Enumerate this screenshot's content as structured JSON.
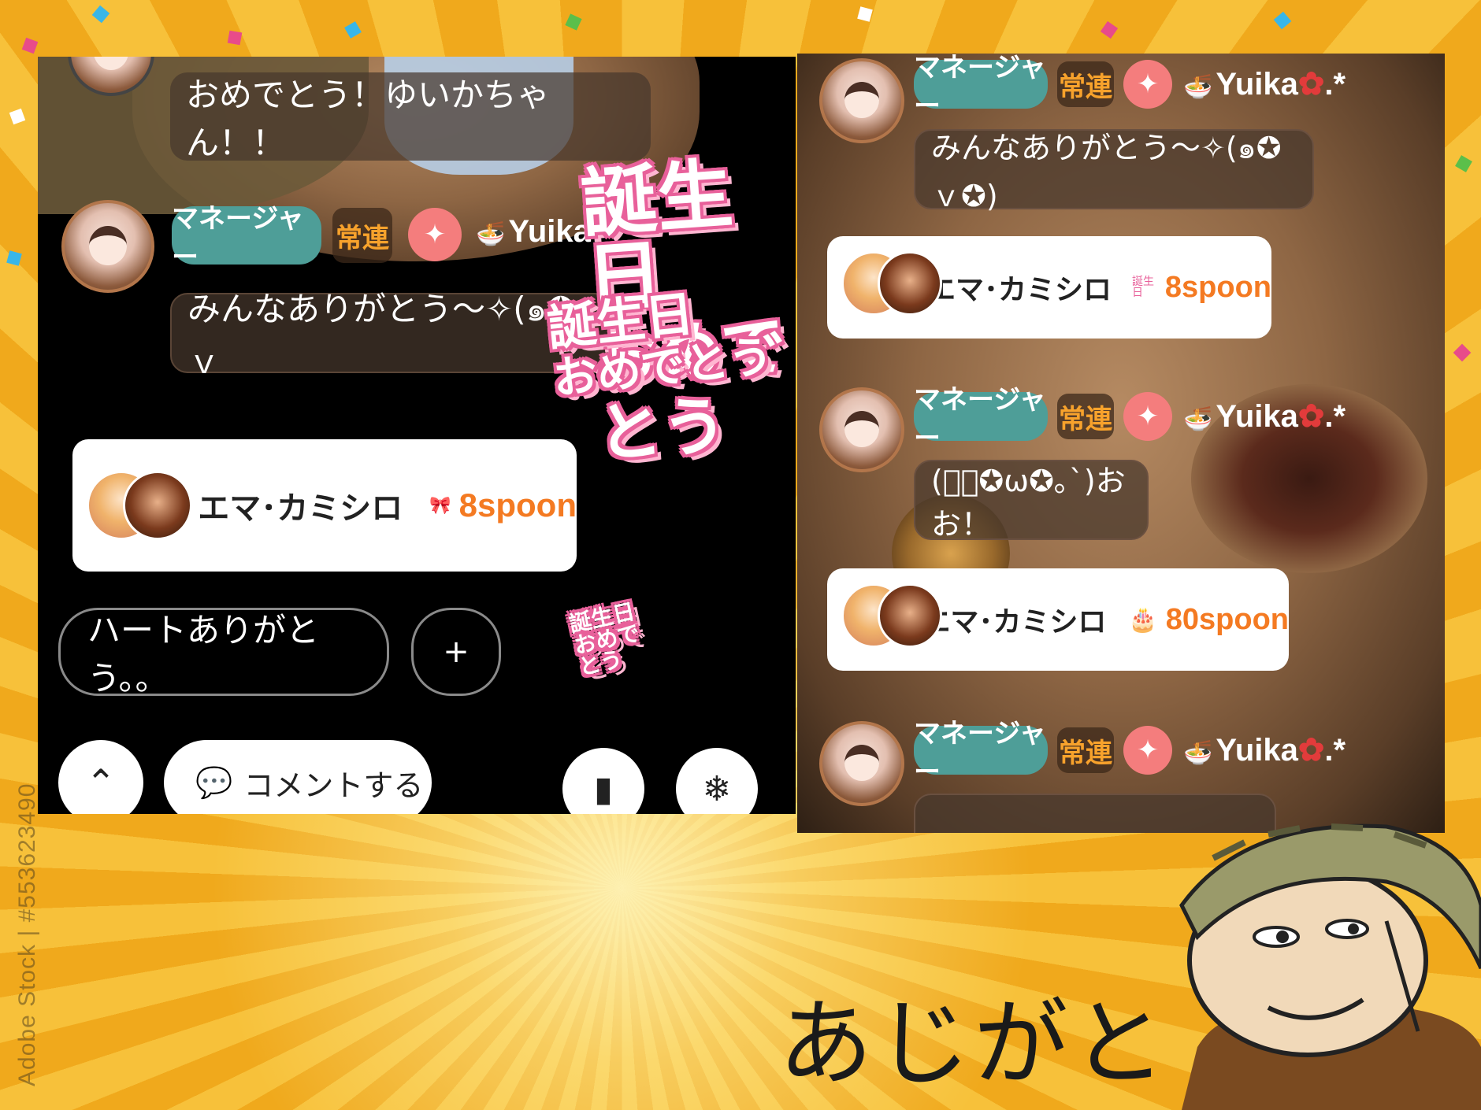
{
  "watermark": "Adobe Stock | #553623490",
  "caption": "あじがと",
  "left_screen": {
    "top_comment": "おめでとう！ゆいかちゃん！！",
    "message": {
      "badge_manager": "マネージャー",
      "badge_regular": "常連",
      "badge_plus": "✦",
      "username": "Yuika",
      "text": "みんなありがとう～✧(๑✪ｖ"
    },
    "gift": {
      "name": "エマ･カミシロ",
      "amount": "8spoon"
    },
    "input_pill": "ハートありがとう。。",
    "add_button": "+",
    "comment_button": "コメントする",
    "sticker_big_line1": "誕生日",
    "sticker_big_line2": "おめでとう",
    "sticker_small": "誕生日おめでとう"
  },
  "right_screen": {
    "messages": [
      {
        "badge_manager": "マネージャー",
        "badge_regular": "常連",
        "badge_plus": "✦",
        "username": "Yuika",
        "suffix": ".*",
        "text": "みんなありがとう～✧(๑✪ｖ✪)"
      },
      {
        "badge_manager": "マネージャー",
        "badge_regular": "常連",
        "badge_plus": "✦",
        "username": "Yuika",
        "suffix": ".*",
        "text": "(ﾟ｡✪ω✪｡`)おお！"
      },
      {
        "badge_manager": "マネージャー",
        "badge_regular": "常連",
        "badge_plus": "✦",
        "username": "Yuika",
        "suffix": ".*",
        "text": ""
      }
    ],
    "gifts": [
      {
        "name": "エマ･カミシロ",
        "amount": "8spoon",
        "sticker": "誕生日"
      },
      {
        "name": "エマ･カミシロ",
        "amount": "80spoon",
        "sticker": "🎂"
      }
    ]
  },
  "colors": {
    "manager_badge": "#4e9e98",
    "regular_text": "#f7a22c",
    "plus_badge": "#f47d7d",
    "spoon_amount": "#f47a22",
    "sticker_pink": "#e8609a"
  }
}
